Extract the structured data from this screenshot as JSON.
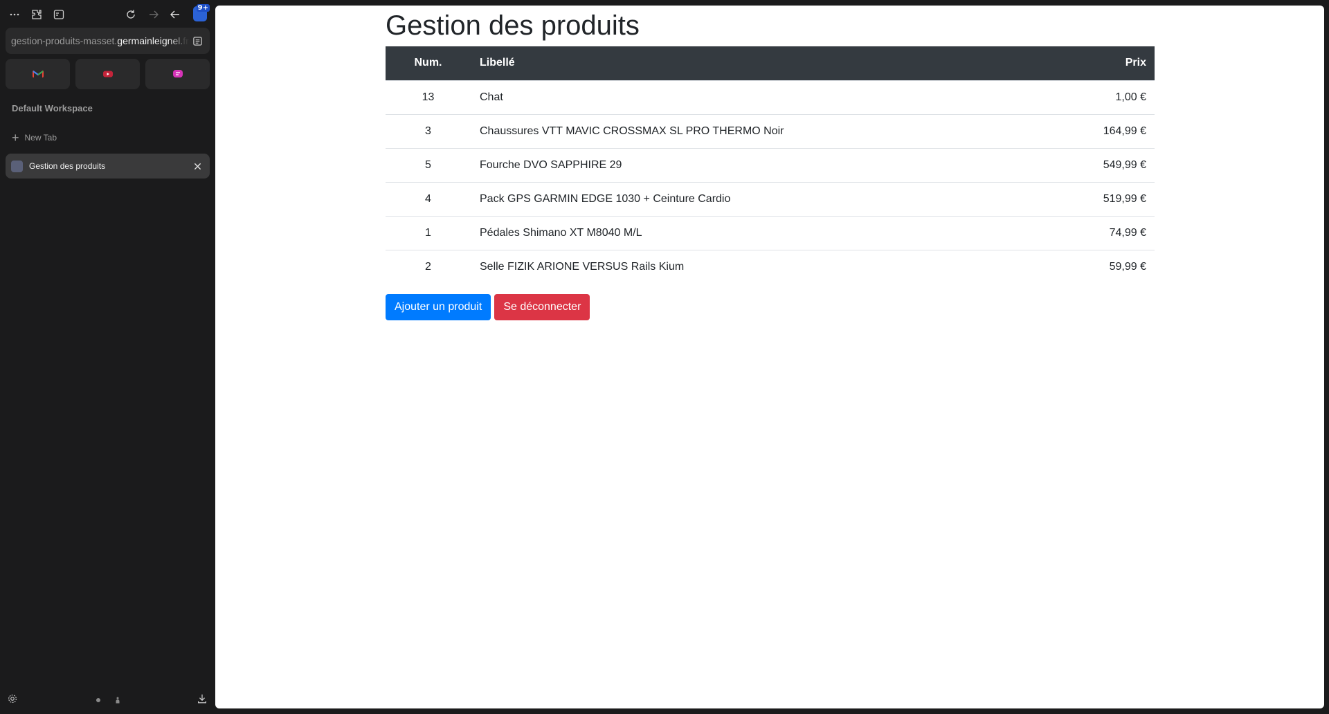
{
  "browser": {
    "url_prefix": "gestion-produits-masset.",
    "url_host": "germainleignel.",
    "url_suffix": "fr",
    "extension_badge": "9+",
    "workspace_label": "Default Workspace",
    "new_tab_label": "New Tab",
    "active_tab_title": "Gestion des produits",
    "pinned": [
      {
        "icon": "gmail-icon",
        "color": "#ea4335"
      },
      {
        "icon": "youtube-icon",
        "color": "#e0243f"
      },
      {
        "icon": "chat-icon",
        "color": "#d633b8"
      }
    ]
  },
  "page": {
    "title": "Gestion des produits",
    "table": {
      "headers": {
        "num": "Num.",
        "libelle": "Libellé",
        "prix": "Prix"
      },
      "rows": [
        {
          "num": "13",
          "libelle": "Chat",
          "prix": "1,00 €"
        },
        {
          "num": "3",
          "libelle": "Chaussures VTT MAVIC CROSSMAX SL PRO THERMO Noir",
          "prix": "164,99 €"
        },
        {
          "num": "5",
          "libelle": "Fourche DVO SAPPHIRE 29",
          "prix": "549,99 €"
        },
        {
          "num": "4",
          "libelle": "Pack GPS GARMIN EDGE 1030 + Ceinture Cardio",
          "prix": "519,99 €"
        },
        {
          "num": "1",
          "libelle": "Pédales Shimano XT M8040 M/L",
          "prix": "74,99 €"
        },
        {
          "num": "2",
          "libelle": "Selle FIZIK ARIONE VERSUS Rails Kium",
          "prix": "59,99 €"
        }
      ]
    },
    "buttons": {
      "add": "Ajouter un produit",
      "logout": "Se déconnecter"
    }
  }
}
